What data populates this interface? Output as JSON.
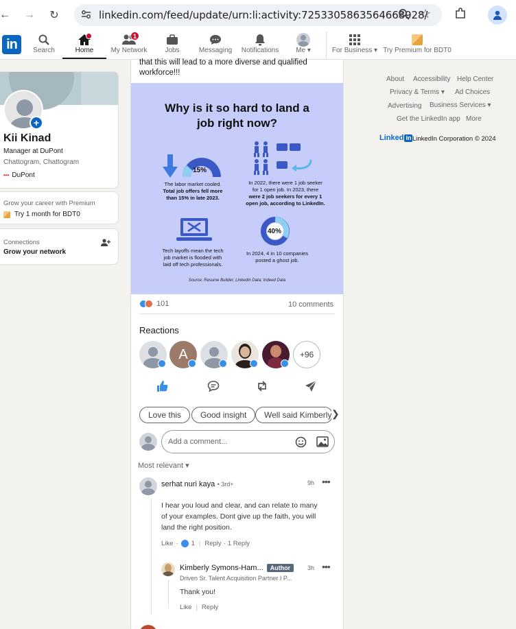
{
  "browser": {
    "url": "linkedin.com/feed/update/urn:li:activity:7253305863564668928/"
  },
  "nav": {
    "items": [
      {
        "label": "Search"
      },
      {
        "label": "Home"
      },
      {
        "label": "My Network",
        "badge": "1"
      },
      {
        "label": "Jobs"
      },
      {
        "label": "Messaging"
      },
      {
        "label": "Notifications"
      },
      {
        "label": "Me"
      },
      {
        "label": "For Business"
      },
      {
        "label": "Try Premium for BDT0"
      }
    ]
  },
  "profile": {
    "name": "Kii Kinad",
    "headline": "Manager at DuPont",
    "location": "Chattogram, Chattogram",
    "company": "DuPont"
  },
  "premium_card": {
    "line1": "Grow your career with Premium",
    "line2": "Try 1 month for BDT0"
  },
  "connections_card": {
    "line1": "Connections",
    "line2": "Grow your network"
  },
  "post": {
    "text_line1": "that this will lead to a more diverse and qualified",
    "text_line2": "workforce!!!",
    "infographic": {
      "title_line1": "Why is it so hard to land a",
      "title_line2": "job right now?",
      "pct1": "15%",
      "cap1_l1": "The labor market cooled.",
      "cap1_l2": "Total job offers fell more",
      "cap1_l3": "than 15% in late 2023.",
      "cap2_l1": "In 2022, there were 1 job seeker",
      "cap2_l2": "for 1 open job. In 2023, there",
      "cap2_l3": "were 2 job seekers for every 1",
      "cap2_l4": "open job, according to LinkedIn.",
      "cap3_l1": "Tech layoffs mean the tech",
      "cap3_l2": "job market is flooded with",
      "cap3_l3": "laid off tech professionals.",
      "pct2": "40%",
      "cap4_l1": "In 2024, 4 in 10 companies",
      "cap4_l2": "posted a ghost job.",
      "source": "Source: Resume Builder; LinkedIn Data; Indeed Data"
    },
    "reactions_count": "101",
    "comments_count": "10 comments",
    "reactions_heading": "Reactions",
    "more_reactors": "+96",
    "reactor_initial": "A",
    "suggestions": [
      "Love this",
      "Good insight",
      "Well said Kimberly"
    ],
    "comment_placeholder": "Add a comment...",
    "sort_label": "Most relevant"
  },
  "comments": [
    {
      "name": "serhat nuri kaya",
      "degree": "• 3rd+",
      "time": "9h",
      "body_l1": "I hear you loud and clear, and can relate to many",
      "body_l2": "of your examples. Dont give up the faith, you will",
      "body_l3": "land the right position.",
      "like": "Like",
      "like_count": "1",
      "reply": "Reply",
      "replies": "1 Reply"
    },
    {
      "name": "Kimberly Symons-Ham...",
      "badge": "Author",
      "headline": "Driven Sr. Talent Acquisition Partner I P...",
      "time": "3h",
      "body": "Thank you!",
      "like": "Like",
      "reply": "Reply"
    }
  ],
  "right_links": {
    "about": "About",
    "accessibility": "Accessibility",
    "help": "Help Center",
    "privacy": "Privacy & Terms",
    "ad_choices": "Ad Choices",
    "advertising": "Advertising",
    "business_services": "Business Services",
    "get_app": "Get the LinkedIn app",
    "more": "More",
    "brand": "Linked",
    "copyright": "LinkedIn Corporation © 2024"
  },
  "colors": {
    "brand_blue": "#0a66c2",
    "infographic_bg": "#c6cdfb",
    "badge_red": "#cb112d"
  }
}
